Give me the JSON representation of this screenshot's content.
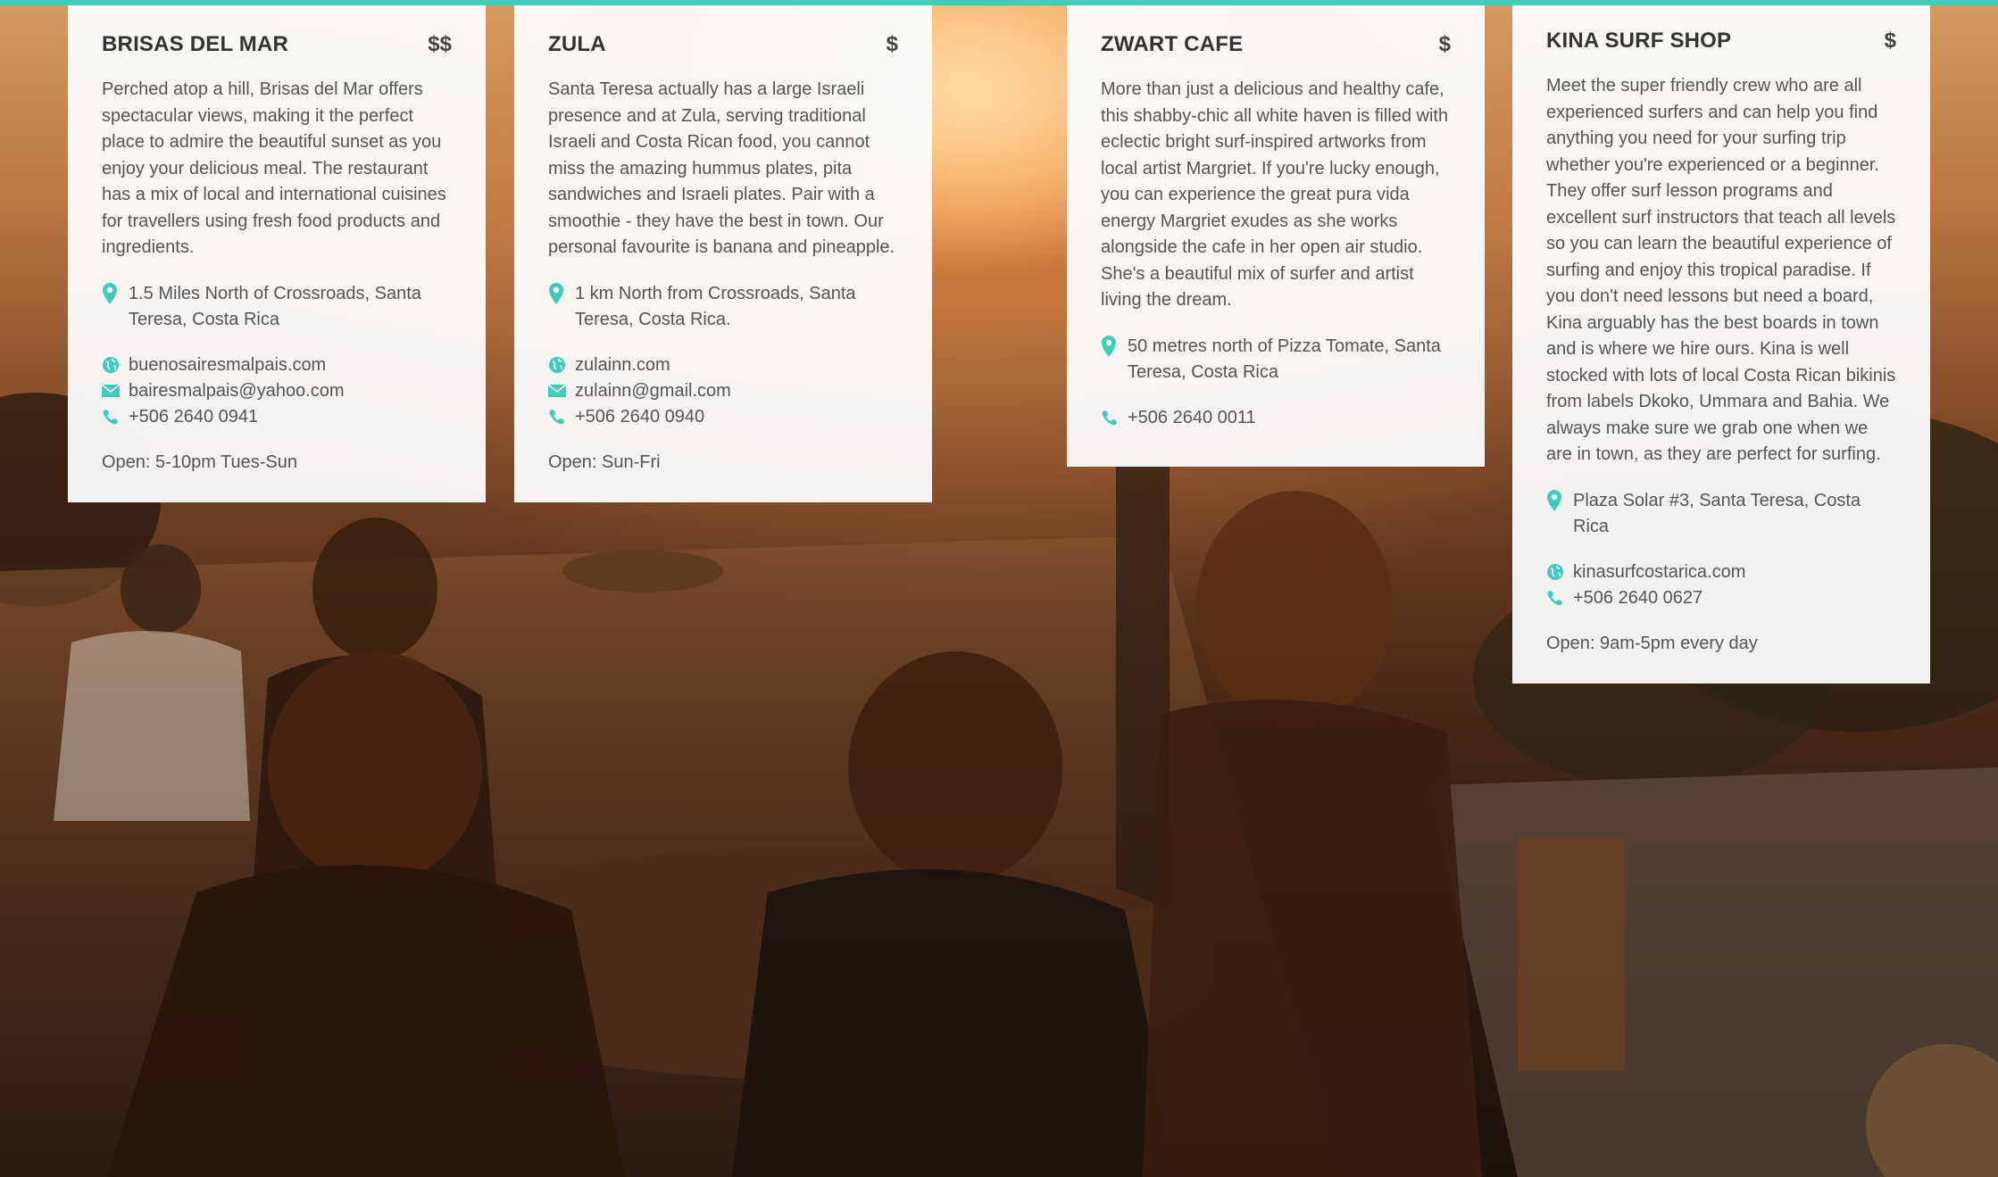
{
  "accent_color": "#3fcdbb",
  "cards": [
    {
      "title": "BRISAS DEL MAR",
      "price": "$$",
      "description": "Perched atop a hill, Brisas del Mar offers spectacular views, making it the perfect place to admire the beautiful sunset as you enjoy your delicious meal. The restaurant has a mix of local and international cuisines for travellers using fresh food products and ingredients.",
      "address": "1.5 Miles North of Crossroads, Santa Teresa, Costa Rica",
      "website": "buenosairesmalpais.com",
      "email": "bairesmalpais@yahoo.com",
      "phone": "+506 2640 0941",
      "hours": "Open: 5-10pm Tues-Sun"
    },
    {
      "title": "ZULA",
      "price": "$",
      "description": "Santa Teresa actually has a large Israeli presence and at Zula, serving traditional Israeli and Costa Rican food, you cannot miss the amazing hummus plates, pita sandwiches and Israeli plates. Pair with a smoothie - they have the best in town. Our personal favourite is banana and pineapple.",
      "address": "1 km North from Crossroads, Santa Teresa, Costa Rica.",
      "website": "zulainn.com",
      "email": "zulainn@gmail.com",
      "phone": "+506 2640 0940",
      "hours": "Open: Sun-Fri"
    },
    {
      "title": "ZWART CAFE",
      "price": "$",
      "description": "More than just a delicious and healthy cafe, this shabby-chic all white haven is filled with eclectic bright surf-inspired artworks from local artist Margriet. If you're lucky enough, you can experience the great pura vida energy Margriet exudes as she works alongside the cafe in her open air studio. She's a beautiful mix of surfer and artist living the dream.",
      "address": "50 metres north of Pizza Tomate, Santa Teresa, Costa Rica",
      "phone": "+506 2640 0011"
    },
    {
      "title": "KINA SURF SHOP",
      "price": "$",
      "description": "Meet the super friendly crew who are all experienced surfers and can help you find anything you need for your surfing trip whether you're experienced or a beginner. They offer surf lesson programs and excellent surf instructors that teach all levels so you can learn the beautiful experience of surfing and enjoy this tropical paradise. If you don't need lessons but need a board, Kina arguably has the best boards in town and is where we hire ours. Kina is well stocked with lots of local Costa Rican bikinis from labels Dkoko, Ummara and Bahia. We always make sure we grab one when we are in town, as they are perfect for surfing.",
      "address": "Plaza Solar #3, Santa Teresa, Costa Rica",
      "website": "kinasurfcostarica.com",
      "phone": "+506 2640 0627",
      "hours": "Open: 9am-5pm every day"
    }
  ]
}
